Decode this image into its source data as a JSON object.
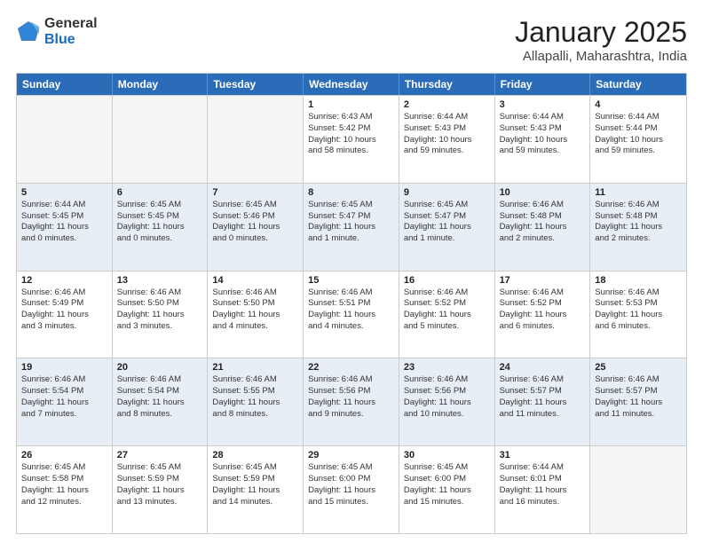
{
  "logo": {
    "general": "General",
    "blue": "Blue"
  },
  "title": "January 2025",
  "location": "Allapalli, Maharashtra, India",
  "days_of_week": [
    "Sunday",
    "Monday",
    "Tuesday",
    "Wednesday",
    "Thursday",
    "Friday",
    "Saturday"
  ],
  "weeks": [
    [
      {
        "day": "",
        "info": ""
      },
      {
        "day": "",
        "info": ""
      },
      {
        "day": "",
        "info": ""
      },
      {
        "day": "1",
        "info": "Sunrise: 6:43 AM\nSunset: 5:42 PM\nDaylight: 10 hours\nand 58 minutes."
      },
      {
        "day": "2",
        "info": "Sunrise: 6:44 AM\nSunset: 5:43 PM\nDaylight: 10 hours\nand 59 minutes."
      },
      {
        "day": "3",
        "info": "Sunrise: 6:44 AM\nSunset: 5:43 PM\nDaylight: 10 hours\nand 59 minutes."
      },
      {
        "day": "4",
        "info": "Sunrise: 6:44 AM\nSunset: 5:44 PM\nDaylight: 10 hours\nand 59 minutes."
      }
    ],
    [
      {
        "day": "5",
        "info": "Sunrise: 6:44 AM\nSunset: 5:45 PM\nDaylight: 11 hours\nand 0 minutes."
      },
      {
        "day": "6",
        "info": "Sunrise: 6:45 AM\nSunset: 5:45 PM\nDaylight: 11 hours\nand 0 minutes."
      },
      {
        "day": "7",
        "info": "Sunrise: 6:45 AM\nSunset: 5:46 PM\nDaylight: 11 hours\nand 0 minutes."
      },
      {
        "day": "8",
        "info": "Sunrise: 6:45 AM\nSunset: 5:47 PM\nDaylight: 11 hours\nand 1 minute."
      },
      {
        "day": "9",
        "info": "Sunrise: 6:45 AM\nSunset: 5:47 PM\nDaylight: 11 hours\nand 1 minute."
      },
      {
        "day": "10",
        "info": "Sunrise: 6:46 AM\nSunset: 5:48 PM\nDaylight: 11 hours\nand 2 minutes."
      },
      {
        "day": "11",
        "info": "Sunrise: 6:46 AM\nSunset: 5:48 PM\nDaylight: 11 hours\nand 2 minutes."
      }
    ],
    [
      {
        "day": "12",
        "info": "Sunrise: 6:46 AM\nSunset: 5:49 PM\nDaylight: 11 hours\nand 3 minutes."
      },
      {
        "day": "13",
        "info": "Sunrise: 6:46 AM\nSunset: 5:50 PM\nDaylight: 11 hours\nand 3 minutes."
      },
      {
        "day": "14",
        "info": "Sunrise: 6:46 AM\nSunset: 5:50 PM\nDaylight: 11 hours\nand 4 minutes."
      },
      {
        "day": "15",
        "info": "Sunrise: 6:46 AM\nSunset: 5:51 PM\nDaylight: 11 hours\nand 4 minutes."
      },
      {
        "day": "16",
        "info": "Sunrise: 6:46 AM\nSunset: 5:52 PM\nDaylight: 11 hours\nand 5 minutes."
      },
      {
        "day": "17",
        "info": "Sunrise: 6:46 AM\nSunset: 5:52 PM\nDaylight: 11 hours\nand 6 minutes."
      },
      {
        "day": "18",
        "info": "Sunrise: 6:46 AM\nSunset: 5:53 PM\nDaylight: 11 hours\nand 6 minutes."
      }
    ],
    [
      {
        "day": "19",
        "info": "Sunrise: 6:46 AM\nSunset: 5:54 PM\nDaylight: 11 hours\nand 7 minutes."
      },
      {
        "day": "20",
        "info": "Sunrise: 6:46 AM\nSunset: 5:54 PM\nDaylight: 11 hours\nand 8 minutes."
      },
      {
        "day": "21",
        "info": "Sunrise: 6:46 AM\nSunset: 5:55 PM\nDaylight: 11 hours\nand 8 minutes."
      },
      {
        "day": "22",
        "info": "Sunrise: 6:46 AM\nSunset: 5:56 PM\nDaylight: 11 hours\nand 9 minutes."
      },
      {
        "day": "23",
        "info": "Sunrise: 6:46 AM\nSunset: 5:56 PM\nDaylight: 11 hours\nand 10 minutes."
      },
      {
        "day": "24",
        "info": "Sunrise: 6:46 AM\nSunset: 5:57 PM\nDaylight: 11 hours\nand 11 minutes."
      },
      {
        "day": "25",
        "info": "Sunrise: 6:46 AM\nSunset: 5:57 PM\nDaylight: 11 hours\nand 11 minutes."
      }
    ],
    [
      {
        "day": "26",
        "info": "Sunrise: 6:45 AM\nSunset: 5:58 PM\nDaylight: 11 hours\nand 12 minutes."
      },
      {
        "day": "27",
        "info": "Sunrise: 6:45 AM\nSunset: 5:59 PM\nDaylight: 11 hours\nand 13 minutes."
      },
      {
        "day": "28",
        "info": "Sunrise: 6:45 AM\nSunset: 5:59 PM\nDaylight: 11 hours\nand 14 minutes."
      },
      {
        "day": "29",
        "info": "Sunrise: 6:45 AM\nSunset: 6:00 PM\nDaylight: 11 hours\nand 15 minutes."
      },
      {
        "day": "30",
        "info": "Sunrise: 6:45 AM\nSunset: 6:00 PM\nDaylight: 11 hours\nand 15 minutes."
      },
      {
        "day": "31",
        "info": "Sunrise: 6:44 AM\nSunset: 6:01 PM\nDaylight: 11 hours\nand 16 minutes."
      },
      {
        "day": "",
        "info": ""
      }
    ]
  ]
}
